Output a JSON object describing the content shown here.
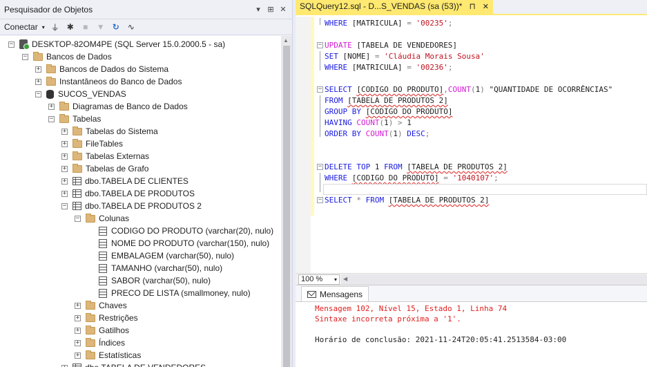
{
  "object_explorer": {
    "title": "Pesquisador de Objetos",
    "title_buttons": [
      "▾",
      "⊞",
      "✕"
    ],
    "toolbar": {
      "connect_label": "Conectar"
    },
    "tree": [
      {
        "label": "DESKTOP-82OM4PE (SQL Server 15.0.2000.5 - sa)",
        "icon": "server-icon",
        "expander": "−"
      },
      {
        "label": "Bancos de Dados",
        "icon": "folder-icon",
        "expander": "−"
      },
      {
        "label": "Bancos de Dados do Sistema",
        "icon": "folder-icon",
        "expander": "+"
      },
      {
        "label": "Instantâneos do Banco de Dados",
        "icon": "folder-icon",
        "expander": "+"
      },
      {
        "label": "SUCOS_VENDAS",
        "icon": "database-icon",
        "expander": "−"
      },
      {
        "label": "Diagramas de Banco de Dados",
        "icon": "folder-icon",
        "expander": "+"
      },
      {
        "label": "Tabelas",
        "icon": "folder-icon",
        "expander": "−"
      },
      {
        "label": "Tabelas do Sistema",
        "icon": "folder-icon",
        "expander": "+"
      },
      {
        "label": "FileTables",
        "icon": "folder-icon",
        "expander": "+"
      },
      {
        "label": "Tabelas Externas",
        "icon": "folder-icon",
        "expander": "+"
      },
      {
        "label": "Tabelas de Grafo",
        "icon": "folder-icon",
        "expander": "+"
      },
      {
        "label": "dbo.TABELA DE CLIENTES",
        "icon": "table-icon",
        "expander": "+"
      },
      {
        "label": "dbo.TABELA DE PRODUTOS",
        "icon": "table-icon",
        "expander": "+"
      },
      {
        "label": "dbo.TABELA DE PRODUTOS 2",
        "icon": "table-icon",
        "expander": "−"
      },
      {
        "label": "Colunas",
        "icon": "folder-icon",
        "expander": "−"
      },
      {
        "label": "CODIGO DO PRODUTO (varchar(20), nulo)",
        "icon": "column-icon",
        "expander": ""
      },
      {
        "label": "NOME DO PRODUTO (varchar(150), nulo)",
        "icon": "column-icon",
        "expander": ""
      },
      {
        "label": "EMBALAGEM (varchar(50), nulo)",
        "icon": "column-icon",
        "expander": ""
      },
      {
        "label": "TAMANHO (varchar(50), nulo)",
        "icon": "column-icon",
        "expander": ""
      },
      {
        "label": "SABOR (varchar(50), nulo)",
        "icon": "column-icon",
        "expander": ""
      },
      {
        "label": "PRECO DE LISTA (smallmoney, nulo)",
        "icon": "column-icon",
        "expander": ""
      },
      {
        "label": "Chaves",
        "icon": "folder-icon",
        "expander": "+"
      },
      {
        "label": "Restrições",
        "icon": "folder-icon",
        "expander": "+"
      },
      {
        "label": "Gatilhos",
        "icon": "folder-icon",
        "expander": "+"
      },
      {
        "label": "Índices",
        "icon": "folder-icon",
        "expander": "+"
      },
      {
        "label": "Estatísticas",
        "icon": "folder-icon",
        "expander": "+"
      },
      {
        "label": "dbo.TABELA DE VENDEDORES",
        "icon": "table-icon",
        "expander": "+"
      }
    ]
  },
  "editor": {
    "tab_title": "SQLQuery12.sql - D...S_VENDAS (sa (53))*",
    "tab_buttons": [
      "⊓",
      "✕"
    ],
    "code_lines": [
      [
        {
          "t": "WHERE ",
          "c": "kw"
        },
        {
          "t": "[MATRICULA] ",
          "c": ""
        },
        {
          "t": "= ",
          "c": "op"
        },
        {
          "t": "'00235'",
          "c": "str"
        },
        {
          "t": ";",
          "c": "op"
        }
      ],
      [],
      [
        {
          "t": "UPDATE ",
          "c": "fn"
        },
        {
          "t": "[TABELA DE VENDEDORES]",
          "c": ""
        }
      ],
      [
        {
          "t": "SET ",
          "c": "kw"
        },
        {
          "t": "[NOME] ",
          "c": ""
        },
        {
          "t": "= ",
          "c": "op"
        },
        {
          "t": "'Cláudia Morais Sousa'",
          "c": "str"
        }
      ],
      [
        {
          "t": "WHERE ",
          "c": "kw"
        },
        {
          "t": "[MATRICULA] ",
          "c": ""
        },
        {
          "t": "= ",
          "c": "op"
        },
        {
          "t": "'00236'",
          "c": "str"
        },
        {
          "t": ";",
          "c": "op"
        }
      ],
      [],
      [
        {
          "t": "SELECT ",
          "c": "kw"
        },
        {
          "t": "[CODIGO DO PRODUTO]",
          "c": "sq"
        },
        {
          "t": ",",
          "c": "op"
        },
        {
          "t": "COUNT",
          "c": "fn"
        },
        {
          "t": "(",
          "c": "op"
        },
        {
          "t": "1",
          "c": ""
        },
        {
          "t": ") ",
          "c": "op"
        },
        {
          "t": "\"QUANTIDADE DE OCORRÊNCIAS\"",
          "c": ""
        }
      ],
      [
        {
          "t": "FROM ",
          "c": "kw"
        },
        {
          "t": "[TABELA DE PRODUTOS 2]",
          "c": "sq"
        }
      ],
      [
        {
          "t": "GROUP BY ",
          "c": "kw"
        },
        {
          "t": "[CODIGO DO PRODUTO]",
          "c": "sq"
        }
      ],
      [
        {
          "t": "HAVING ",
          "c": "kw"
        },
        {
          "t": "COUNT",
          "c": "fn"
        },
        {
          "t": "(",
          "c": "op"
        },
        {
          "t": "1",
          "c": ""
        },
        {
          "t": ") ",
          "c": "op"
        },
        {
          "t": "> ",
          "c": "op"
        },
        {
          "t": "1",
          "c": ""
        }
      ],
      [
        {
          "t": "ORDER BY ",
          "c": "kw"
        },
        {
          "t": "COUNT",
          "c": "fn"
        },
        {
          "t": "(",
          "c": "op"
        },
        {
          "t": "1",
          "c": ""
        },
        {
          "t": ") ",
          "c": "op"
        },
        {
          "t": "DESC",
          "c": "kw"
        },
        {
          "t": ";",
          "c": "op"
        }
      ],
      [],
      [],
      [
        {
          "t": "DELETE ",
          "c": "kw"
        },
        {
          "t": "TOP ",
          "c": "kw"
        },
        {
          "t": "1 ",
          "c": ""
        },
        {
          "t": "FROM ",
          "c": "kw"
        },
        {
          "t": "[TABELA DE PRODUTOS 2]",
          "c": "sq"
        }
      ],
      [
        {
          "t": "WHERE ",
          "c": "kw"
        },
        {
          "t": "[CODIGO DO PRODUTO]",
          "c": "sq"
        },
        {
          "t": " = ",
          "c": "op"
        },
        {
          "t": "'1040107'",
          "c": "str"
        },
        {
          "t": ";",
          "c": "op"
        }
      ],
      [],
      [
        {
          "t": "SELECT ",
          "c": "kw"
        },
        {
          "t": "* ",
          "c": "op"
        },
        {
          "t": "FROM ",
          "c": "kw"
        },
        {
          "t": "[TABELA DE PRODUTOS 2]",
          "c": "sq"
        }
      ]
    ],
    "zoom": "100 %"
  },
  "results": {
    "tab_label": "Mensagens",
    "messages": [
      {
        "text": "Mensagem 102, Nível 15, Estado 1, Linha 74",
        "error": true
      },
      {
        "text": "Sintaxe incorreta próxima a '1'.",
        "error": true
      },
      {
        "text": "",
        "error": false
      },
      {
        "text": "Horário de conclusão: 2021-11-24T20:05:41.2513584-03:00",
        "error": false
      }
    ]
  },
  "colors": {
    "tab_active": "#ffe971",
    "keyword": "#1a1adf",
    "function": "#d31ad3",
    "string": "#c1121f",
    "error": "#e01e1e"
  }
}
